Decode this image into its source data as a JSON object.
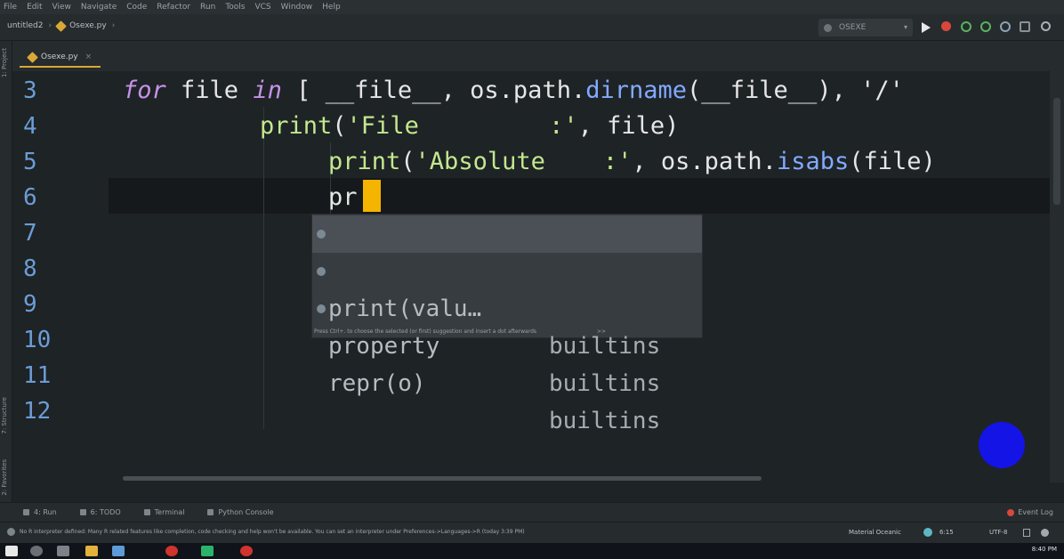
{
  "menu": [
    "File",
    "Edit",
    "View",
    "Navigate",
    "Code",
    "Refactor",
    "Run",
    "Tools",
    "VCS",
    "Window",
    "Help"
  ],
  "breadcrumb": {
    "project": "untitled2",
    "file": "Osexe.py"
  },
  "run_config": {
    "label": "OSEXE"
  },
  "left_tools": {
    "project": "1: Project",
    "structure": "7: Structure",
    "favorites": "2: Favorites"
  },
  "tab": {
    "label": "Osexe.py",
    "close": "×"
  },
  "editor": {
    "line_numbers": [
      "3",
      "4",
      "5",
      "6",
      "7",
      "8",
      "9",
      "10",
      "11",
      "12"
    ],
    "current_line": "6",
    "lines": {
      "l3": {
        "kw1": "for",
        "t1": " file ",
        "kw2": "in",
        "t2": " [ __file__, os.path.",
        "fn": "dirname",
        "t3": "(__file__), '/'"
      },
      "l4": {
        "fn": "print",
        "t1": "(",
        "str": "'File         :'",
        "t2": ", file)"
      },
      "l5": {
        "fn": "print",
        "t1": "(",
        "str": "'Absolute    :'",
        "t2": ", os.path.",
        "fn2": "isabs",
        "t3": "(file)"
      },
      "l6": {
        "typed": "pr"
      }
    }
  },
  "completion": {
    "items": [
      {
        "name": "print(valu…",
        "type": "builtins"
      },
      {
        "name": "property",
        "type": "builtins"
      },
      {
        "name": "repr(o)",
        "type": "builtins"
      }
    ],
    "hint": "Press Ctrl+. to choose the selected (or first) suggestion and insert a dot afterwards",
    "hint_link": ">>"
  },
  "tool_windows": [
    "4: Run",
    "6: TODO",
    "Terminal",
    "Python Console"
  ],
  "event_log": "Event Log",
  "status": {
    "message": "No R interpreter defined: Many R related features like completion, code checking and help won't be available. You can set an interpreter under Preferences->Languages->R (today 3:39 PM)",
    "theme": "Material Oceanic",
    "position": "6:15",
    "line_sep": "",
    "encoding": "UTF-8"
  },
  "taskbar": {
    "clock": "8:40 PM"
  },
  "colors": {
    "caret": "#f4b400",
    "cursor_dot": "#1414e6",
    "keyword": "#c792ea",
    "function": "#c3e88d"
  }
}
